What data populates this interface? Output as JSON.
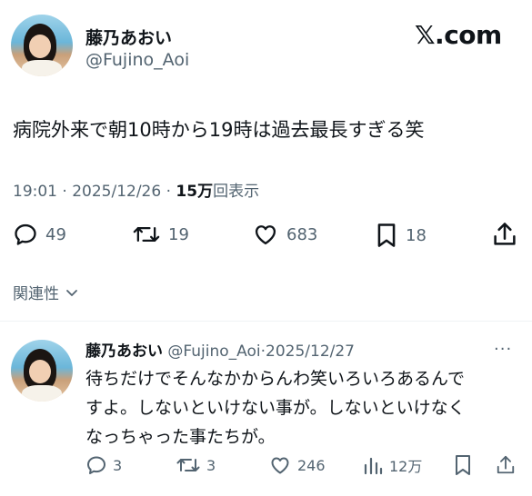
{
  "post": {
    "author_name": "藤乃あおい",
    "author_handle": "@Fujino_Aoi",
    "brand": "𝕏.com",
    "text": "病院外来で朝10時から19時は過去最長すぎる笑",
    "time": "19:01 · 2025/12/26 · ",
    "views_count": "15万",
    "views_label": "回表示",
    "actions": {
      "replies": "49",
      "reposts": "19",
      "likes": "683",
      "bookmarks": "18"
    },
    "related_label": "関連性"
  },
  "reply": {
    "author_name": "藤乃あおい",
    "author_handle": "@Fujino_Aoi",
    "separator": "·",
    "date": "2025/12/27",
    "more": "···",
    "text": "待ちだけでそんなかからんわ笑いろいろあるんで\nすよ。しないといけない事が。しないといけなく\nなっちゃった事たちが。",
    "actions": {
      "replies": "3",
      "reposts": "3",
      "likes": "246",
      "views": "12万"
    }
  }
}
